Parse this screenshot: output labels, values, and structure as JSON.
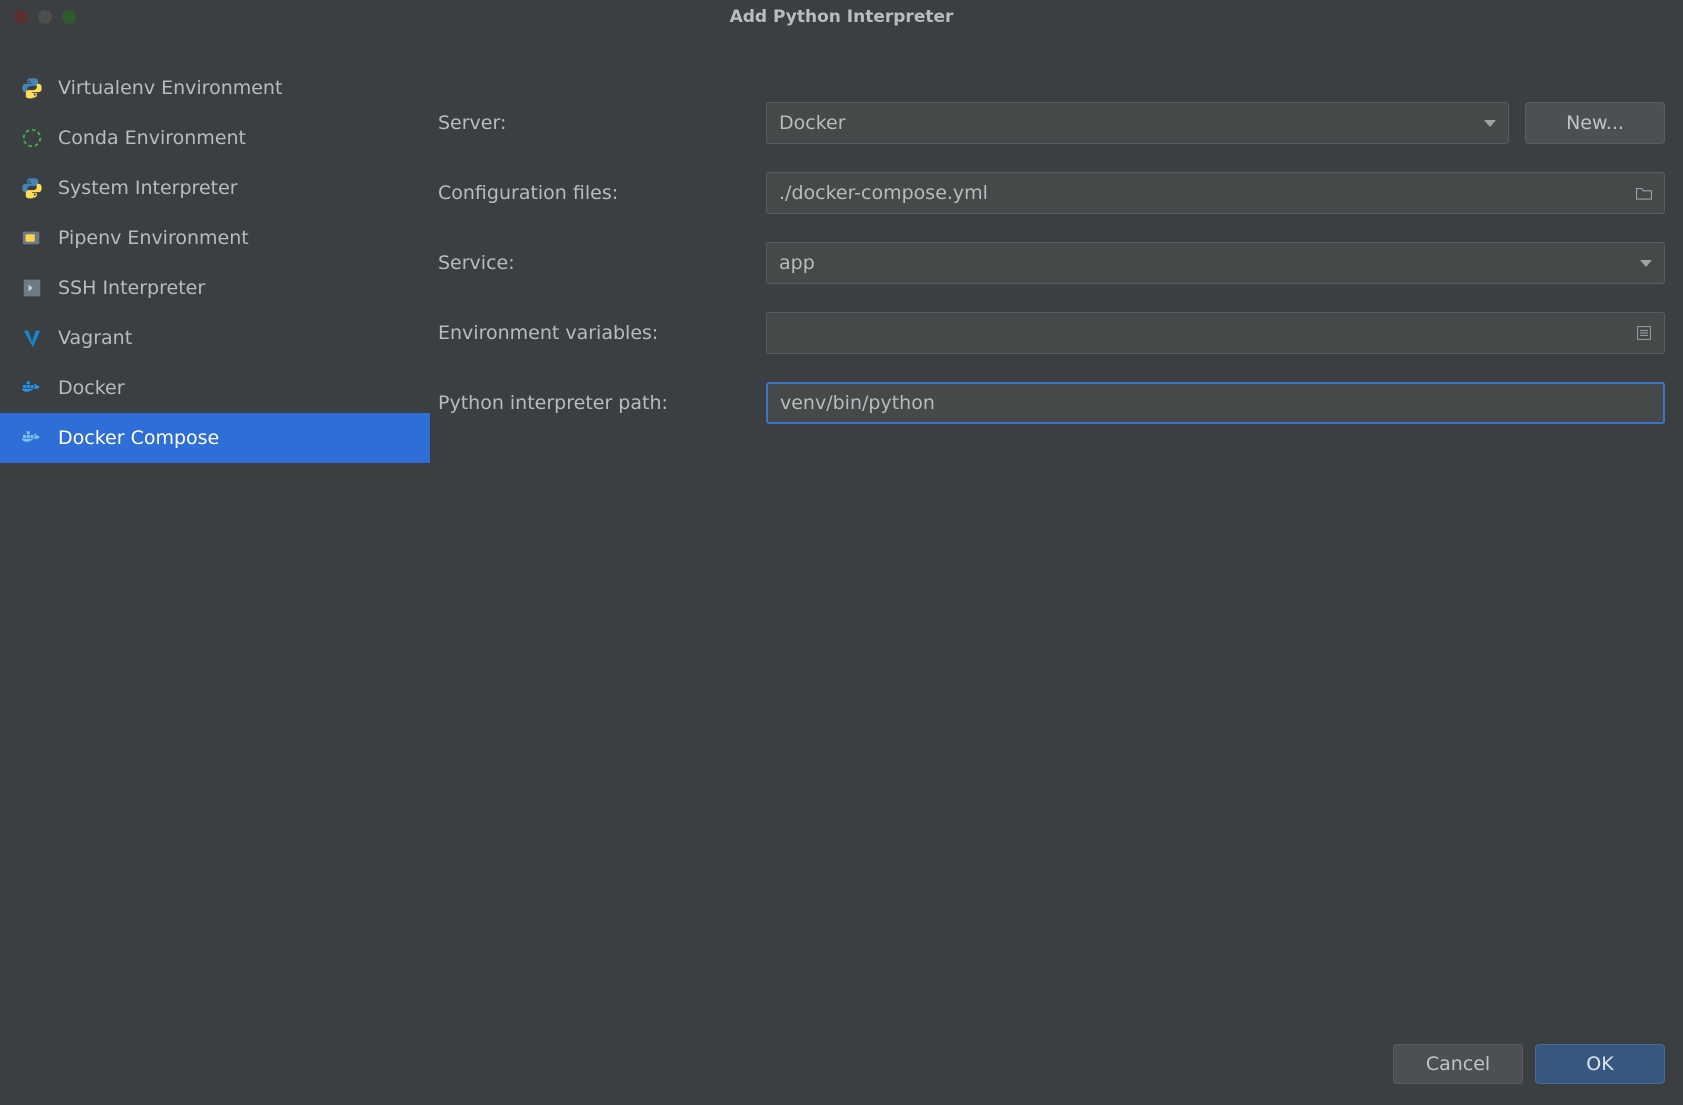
{
  "title": "Add Python Interpreter",
  "sidebar": {
    "items": [
      {
        "label": "Virtualenv Environment",
        "icon": "python-icon"
      },
      {
        "label": "Conda Environment",
        "icon": "conda-icon"
      },
      {
        "label": "System Interpreter",
        "icon": "python-icon"
      },
      {
        "label": "Pipenv Environment",
        "icon": "pipenv-icon"
      },
      {
        "label": "SSH Interpreter",
        "icon": "ssh-icon"
      },
      {
        "label": "Vagrant",
        "icon": "vagrant-icon"
      },
      {
        "label": "Docker",
        "icon": "docker-icon"
      },
      {
        "label": "Docker Compose",
        "icon": "docker-compose-icon",
        "selected": true
      }
    ]
  },
  "form": {
    "server": {
      "label": "Server:",
      "value": "Docker",
      "new_button": "New..."
    },
    "config": {
      "label": "Configuration files:",
      "value": "./docker-compose.yml"
    },
    "service": {
      "label": "Service:",
      "value": "app"
    },
    "env": {
      "label": "Environment variables:",
      "value": ""
    },
    "interpreter": {
      "label": "Python interpreter path:",
      "value": "venv/bin/python"
    }
  },
  "footer": {
    "cancel": "Cancel",
    "ok": "OK"
  },
  "icons": {
    "python-icon": {
      "glyph": "🐍"
    },
    "conda-icon": {
      "glyph": "◯"
    },
    "pipenv-icon": {
      "glyph": "📦"
    },
    "ssh-icon": {
      "glyph": "▶"
    },
    "vagrant-icon": {
      "glyph": "V"
    },
    "docker-icon": {
      "glyph": "🐳"
    },
    "docker-compose-icon": {
      "glyph": "🐳"
    }
  }
}
